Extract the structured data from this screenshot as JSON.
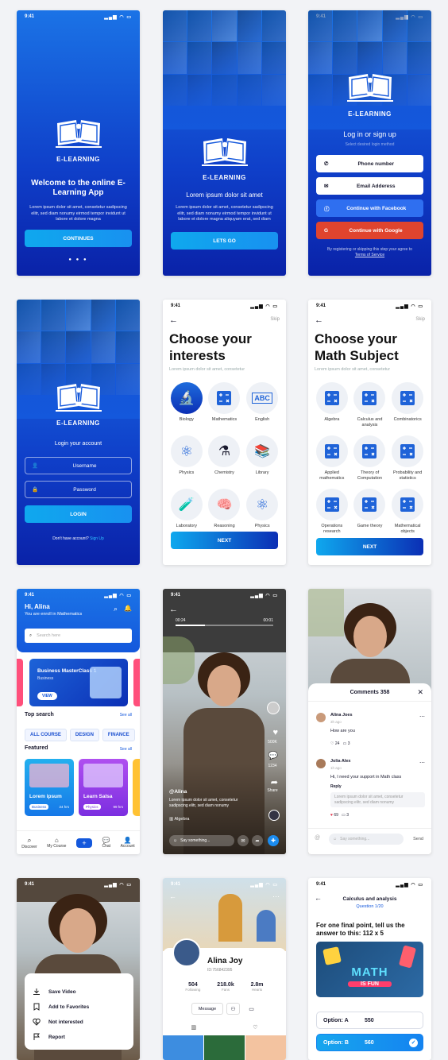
{
  "status_time": "9:41",
  "s1": {
    "brand": "E-LEARNING",
    "title": "Welcome to the online E- Learning App",
    "body": "Lorem ipsum dolor sit amet, consetetur sadipscing elitr, sed diam nonumy eirmod tempor invidunt ut labore et dolore magna",
    "cta": "CONTINUES",
    "dots": "● ● ●"
  },
  "s2": {
    "brand": "E-LEARNING",
    "title": "Lorem ipsum dolor sit amet",
    "body": "Lorem ipsum dolor sit amet, consetetur sadipscing elitr, sed diam nonumy eirmod tempor invidunt ut labore et dolore magna aliquyam erat, sed diam",
    "cta": "LETS GO"
  },
  "s3": {
    "brand": "E-LEARNING",
    "title": "Log in or sign up",
    "subtitle": "Select desired login method",
    "phone": "Phone number",
    "email": "Email Adderess",
    "facebook": "Continue with Facebook",
    "google": "Continue with Google",
    "terms": "By registering or skipping this step your agree to",
    "terms_link": "Terms of Service"
  },
  "s4": {
    "brand": "E-LEARNING",
    "title": "Login your account",
    "username": "Username",
    "password": "Password",
    "cta": "LOGIN",
    "no_account": "Don't have account?",
    "signup": "Sign Up"
  },
  "s5": {
    "skip": "Skip",
    "title_l1": "Choose your",
    "title_l2": "interests",
    "sub": "Lorem ipsum dolor sit amet, consetetur",
    "items": [
      "Biology",
      "Mathematics",
      "English",
      "Physics",
      "Chemistry",
      "Library",
      "Laboratory",
      "Reasoning",
      "Physics"
    ],
    "cta": "NEXT"
  },
  "s6": {
    "skip": "Skip",
    "title_l1": "Choose your",
    "title_l2": "Math Subject",
    "sub": "Lorem ipsum dolor sit amet, consetetur",
    "items": [
      "Algebra",
      "Calculus and analysis",
      "Combinatorics",
      "Applied mathematics",
      "Theory of Computation",
      "Probability and statistics",
      "Operations research",
      "Game theory",
      "Mathematical objects"
    ],
    "cta": "NEXT"
  },
  "s7": {
    "greet": "Hi, Alina",
    "sub": "You are enroll in Mathematics",
    "search": "Search here",
    "banner_title": "Business MasterClass 1",
    "banner_sub": "Business",
    "banner_btn": "VIEW",
    "top_search": "Top search",
    "see_all": "See all",
    "chips": [
      "ALL COURSE",
      "DESIGN",
      "FINANCE"
    ],
    "featured": "Featured",
    "c1_title": "Lorem ipsum",
    "c1_tag": "Business",
    "c1_hrs": "24 hrs",
    "c2_title": "Learn Salsa",
    "c2_tag": "Physics",
    "c2_hrs": "99 hrs",
    "nav": [
      "Discover",
      "My Course",
      "",
      "Chat",
      "Account"
    ]
  },
  "s8": {
    "t_start": "00:24",
    "t_end": "00:01",
    "likes": "500K",
    "comments": "1234",
    "share": "Share",
    "user": "@Alina",
    "caption": "Lorem ipsum dolor sit amet, consetetur sadipscing elitr, sed diam nonumy",
    "tag": "Algebra",
    "say": "Say something..."
  },
  "s9": {
    "header": "Comments 358",
    "c1_name": "Alina Joes",
    "c1_time": "3h ago",
    "c1_text": "How are you",
    "c1_likes": "24",
    "c1_rep": "3",
    "c2_name": "Jolia Alex",
    "c2_time": "1h ago",
    "c2_text": "Hi, I need your support in Math class",
    "reply": "Reply",
    "c2_quote": "Lorem ipsum dolor sit amet, consetetur sadipscing elitr, sed diam nonumy",
    "c2_likes": "69",
    "c2_rep": "3",
    "say": "Say something...",
    "send": "Send"
  },
  "s10": {
    "items": [
      "Save Video",
      "Add to Favorites",
      "Not interested",
      "Report"
    ]
  },
  "s11": {
    "name": "Alina Joy",
    "id": "ID:756842395",
    "following": "504",
    "following_l": "Following",
    "fans": "218.0k",
    "fans_l": "Fans",
    "hearts": "2.8m",
    "hearts_l": "Hearts",
    "message": "Message"
  },
  "s12": {
    "header": "Calculus and analysis",
    "question": "Question 1/20",
    "prompt": "For one final point, tell us the answer to this: 112 x 5",
    "img_t1": "MATH",
    "img_t2": "IS FUN",
    "optA_l": "Option: A",
    "optA_v": "550",
    "optB_l": "Option: B",
    "optB_v": "560"
  },
  "colors": {
    "primary": "#1458dc",
    "accent": "#0fa8ee",
    "dark": "#0a22a8"
  }
}
